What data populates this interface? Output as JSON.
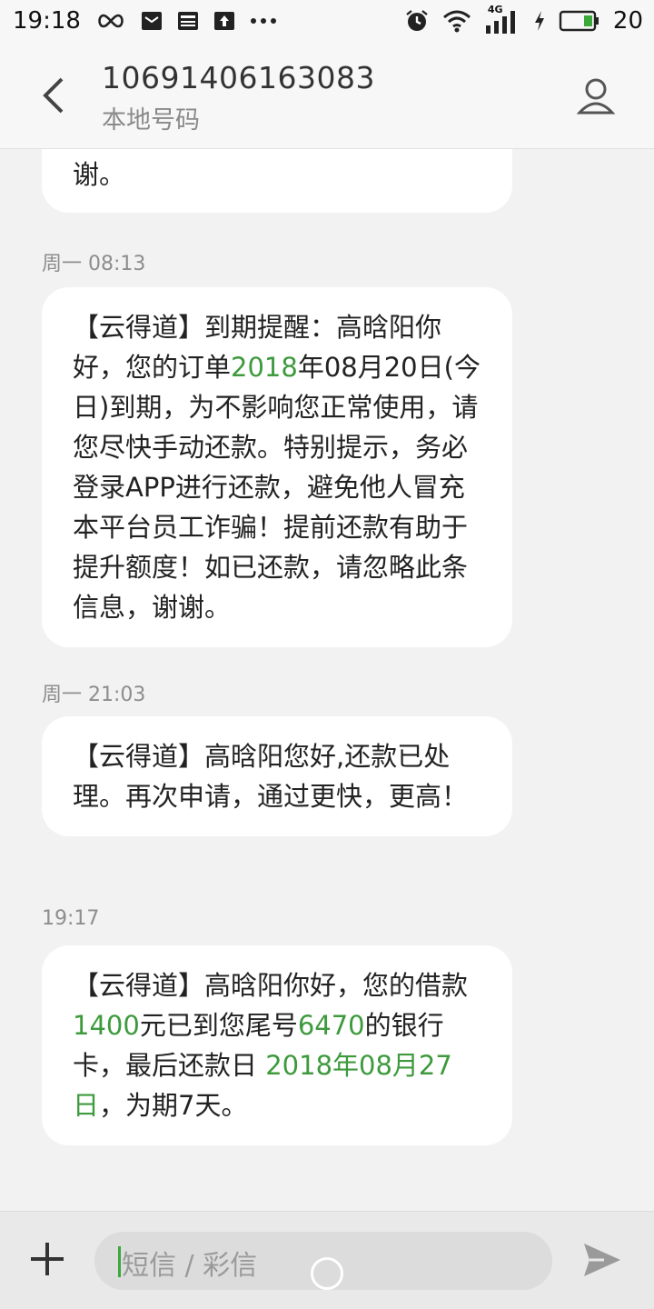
{
  "status_bar": {
    "time": "19:18",
    "network_label": "4G",
    "battery_level": "20",
    "icons": [
      "infinity-icon",
      "mail-icon",
      "news-icon",
      "upload-icon",
      "more-dots-icon",
      "alarm-icon",
      "wifi-icon",
      "signal-icon",
      "charging-icon",
      "battery-icon"
    ]
  },
  "header": {
    "number": "10691406163083",
    "subtitle": "本地号码"
  },
  "messages": {
    "m0": {
      "text": "谢。"
    },
    "m1": {
      "time": "周一 08:13",
      "p1": "【云得道】到期提醒：高晗阳你好，您的订单",
      "h1": "2018",
      "p2": "年08月20日(今日)到期，为不影响您正常使用，请您尽快手动还款。特别提示，务必登录APP进行还款，避免他人冒充本平台员工诈骗！提前还款有助于提升额度！如已还款，请忽略此条信息，谢谢。"
    },
    "m2": {
      "time": "周一 21:03",
      "text": "【云得道】高晗阳您好,还款已处理。再次申请，通过更快，更高！"
    },
    "m3": {
      "time": "19:17",
      "p1": "【云得道】高晗阳你好，您的借款",
      "h1": "1400",
      "p2": "元已到您尾号",
      "h2": "6470",
      "p3": "的银行卡，最后还款日 ",
      "h3": "2018年08月27日",
      "p4": "，为期7天。"
    }
  },
  "composer": {
    "placeholder": "短信 / 彩信"
  },
  "colors": {
    "accent_green": "#3d9a3d",
    "bubble": "#ffffff",
    "background": "#f2f2f2"
  }
}
